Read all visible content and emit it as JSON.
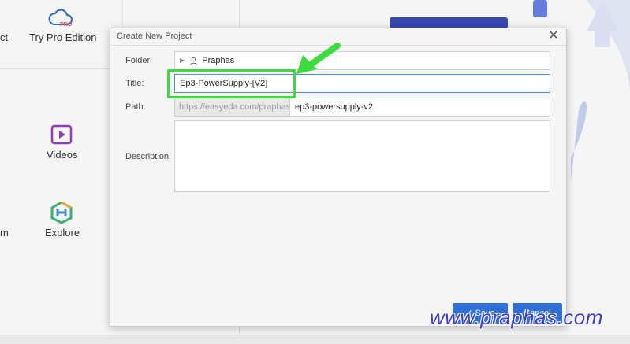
{
  "background": {
    "clipped_left_top": "ct",
    "clipped_left_mid": "m",
    "pro_item_label": "Try Pro Edition",
    "pro_badge": "PRO",
    "videos_label": "Videos",
    "explore_label": "Explore"
  },
  "dialog": {
    "title": "Create New Project",
    "close_symbol": "✕",
    "folder_label": "Folder:",
    "folder_value": "Praphas",
    "title_label": "Title:",
    "title_value": "Ep3-PowerSupply-[V2]",
    "path_label": "Path:",
    "path_prefix": "https://easyeda.com/praphas/",
    "path_value": "ep3-powersupply-v2",
    "description_label": "Description:",
    "description_value": "",
    "save_label": "✓ Save",
    "cancel_label": "Cancel"
  },
  "watermark": "www.praphas.com",
  "colors": {
    "highlight": "#3bdc3b",
    "primary_button": "#2f6fd6",
    "watermark": "#3b3be6"
  }
}
